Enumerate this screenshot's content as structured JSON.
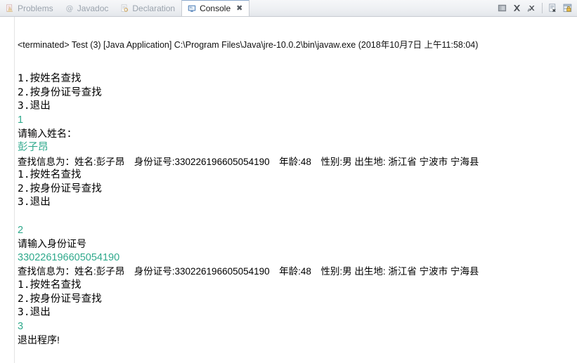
{
  "window": {
    "tabs": [
      {
        "label": "Problems",
        "icon": "problems-icon",
        "active": false
      },
      {
        "label": "Javadoc",
        "icon": "javadoc-icon",
        "active": false
      },
      {
        "label": "Declaration",
        "icon": "declaration-icon",
        "active": false
      },
      {
        "label": "Console",
        "icon": "console-icon",
        "active": true,
        "close": "✖"
      }
    ],
    "toolbar": [
      {
        "name": "terminate-button",
        "title": "Terminate"
      },
      {
        "name": "remove-launch-button",
        "title": "Remove Launch"
      },
      {
        "name": "remove-all-terminated-button",
        "title": "Remove All Terminated Launches"
      },
      {
        "name": "display-selected-console-button",
        "title": "Display Selected Console"
      },
      {
        "name": "pin-console-button",
        "title": "Pin Console"
      }
    ]
  },
  "console": {
    "status_line": "<terminated> Test (3) [Java Application] C:\\Program Files\\Java\\jre-10.0.2\\bin\\javaw.exe (2018年10月7日 上午11:58:04)",
    "colors": {
      "stdout": "#000000",
      "stdin": "#2fa98c",
      "background": "#ffffff"
    },
    "lines": [
      {
        "text": "1.按姓名查找",
        "kind": "menu",
        "stream": "stdout"
      },
      {
        "text": "2.按身份证号查找",
        "kind": "menu",
        "stream": "stdout"
      },
      {
        "text": "3.退出",
        "kind": "menu",
        "stream": "stdout"
      },
      {
        "text": "1",
        "kind": "input",
        "stream": "stdin"
      },
      {
        "text": "请输入姓名：",
        "kind": "prompt",
        "stream": "stdout"
      },
      {
        "text": "彭子昂",
        "kind": "input",
        "stream": "stdin"
      },
      {
        "text": "查找信息为：姓名:彭子昂　身份证号:330226196605054190　年龄:48　性别:男 出生地: 浙江省 宁波市 宁海县",
        "kind": "info",
        "stream": "stdout"
      },
      {
        "text": "1.按姓名查找",
        "kind": "menu",
        "stream": "stdout"
      },
      {
        "text": "2.按身份证号查找",
        "kind": "menu",
        "stream": "stdout"
      },
      {
        "text": "3.退出",
        "kind": "menu",
        "stream": "stdout"
      },
      {
        "text": "",
        "kind": "blank",
        "stream": "stdout"
      },
      {
        "text": "2",
        "kind": "input",
        "stream": "stdin"
      },
      {
        "text": "请输入身份证号",
        "kind": "prompt",
        "stream": "stdout"
      },
      {
        "text": "330226196605054190",
        "kind": "input",
        "stream": "stdin"
      },
      {
        "text": "查找信息为：姓名:彭子昂　身份证号:330226196605054190　年龄:48　性别:男 出生地: 浙江省 宁波市 宁海县",
        "kind": "info",
        "stream": "stdout"
      },
      {
        "text": "1.按姓名查找",
        "kind": "menu",
        "stream": "stdout"
      },
      {
        "text": "2.按身份证号查找",
        "kind": "menu",
        "stream": "stdout"
      },
      {
        "text": "3.退出",
        "kind": "menu",
        "stream": "stdout"
      },
      {
        "text": "3",
        "kind": "input",
        "stream": "stdin"
      },
      {
        "text": "退出程序!",
        "kind": "prompt",
        "stream": "stdout"
      }
    ]
  }
}
